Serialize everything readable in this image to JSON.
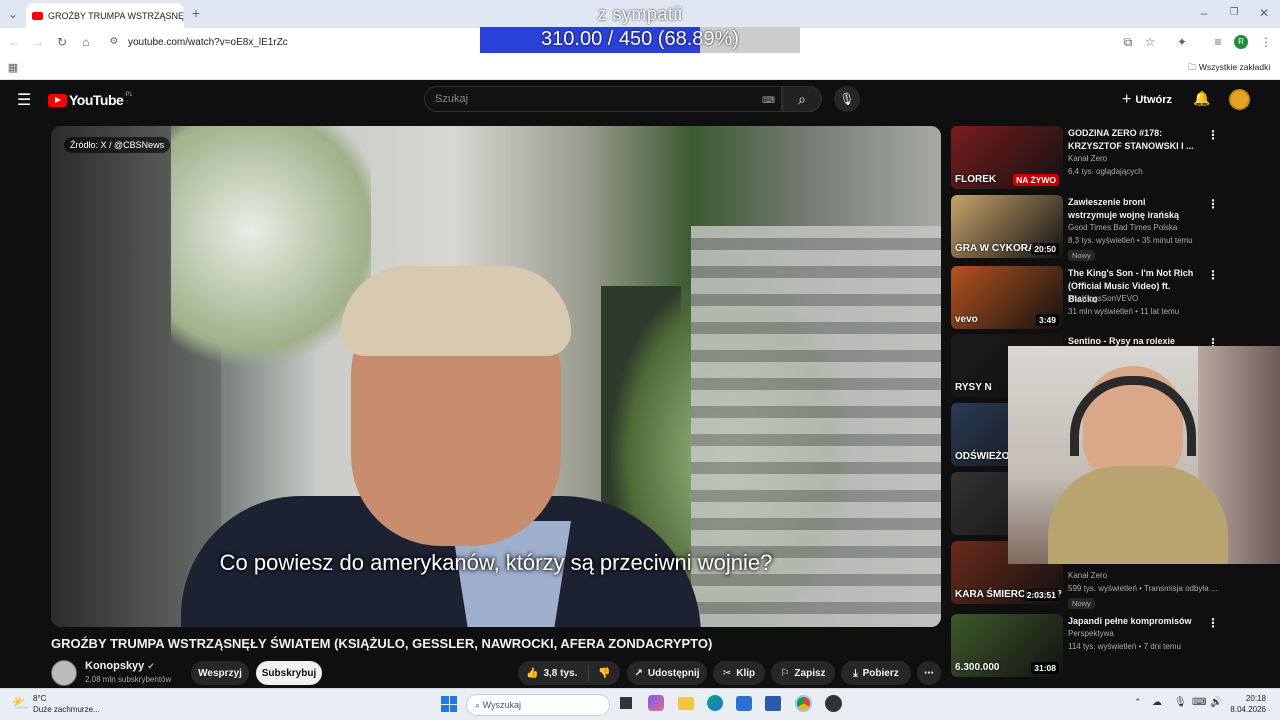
{
  "browser": {
    "tab_title": "GROŹBY TRUMPA WSTRZĄSNĘ",
    "url": "youtube.com/watch?v=oE8x_lE1rZc",
    "all_bookmarks": "Wszystkie zakładki",
    "profile_initial": "R"
  },
  "overlay": {
    "title": "z sympatii",
    "progress_text": "310.00 / 450 (68.89%)",
    "progress_fraction": 0.6889
  },
  "youtube": {
    "logo_text": "YouTube",
    "region": "PL",
    "search_placeholder": "Szukaj",
    "create_label": "Utwórz"
  },
  "video": {
    "source_label": "Źródło: X / @CBSNews",
    "subtitle": "Co powiesz do amerykanów, którzy są przeciwni wojnie?",
    "title": "GROŹBY TRUMPA WSTRZĄSNĘŁY ŚWIATEM (KSIĄŻULO, GESSLER, NAWROCKI, AFERA ZONDACRYPTO)",
    "channel": "Konopskyy",
    "subscribers": "2,08 mln subskrybentów",
    "support_label": "Wesprzyj",
    "subscribe_label": "Subskrybuj",
    "likes": "3,8 tys.",
    "share_label": "Udostępnij",
    "clip_label": "Klip",
    "save_label": "Zapisz",
    "download_label": "Pobierz"
  },
  "sidebar": [
    {
      "title": "GODZINA ZERO #178: KRZYSZTOF STANOWSKI I ...",
      "channel": "Kanał Zero",
      "meta": "6,4 tys. oglądających",
      "duration": "",
      "badge": "",
      "thumb_text": "FLOREK",
      "live_label": "NA ŻYWO",
      "thumb_color": "#7a1d1d"
    },
    {
      "title": "Zawieszenie broni wstrzymuje wojnę irańską",
      "channel": "Good Times Bad Times Polska",
      "meta": "8,3 tys. wyświetleń • 35 minut temu",
      "duration": "20:50",
      "badge": "Nowy",
      "thumb_text": "GRA W CYKORA?",
      "thumb_color": "#c7a36a"
    },
    {
      "title": "The King's Son - I'm Not Rich (Official Music Video) ft. Blacko",
      "channel": "TheKingsSonVEVO",
      "meta": "31 mln wyświetleń • 11 lat temu",
      "duration": "3:49",
      "badge": "",
      "thumb_text": "vevo",
      "thumb_color": "#b5531e"
    },
    {
      "title": "Sentino - Rysy na rolexie (prod.",
      "channel": "",
      "meta": "",
      "duration": "",
      "badge": "",
      "thumb_text": "RYSY N",
      "thumb_color": "#1a1a1a"
    },
    {
      "title": "",
      "channel": "",
      "meta": "",
      "duration": "",
      "badge": "",
      "thumb_text": "ODŚWIEŻONA LEGE",
      "thumb_color": "#2a3b55"
    },
    {
      "title": "",
      "channel": "",
      "meta": "",
      "duration": "",
      "badge": "",
      "thumb_text": "",
      "thumb_color": "#333333"
    },
    {
      "title": "",
      "channel": "Kanał Zero",
      "meta": "599 tys. wyświetleń • Transmisja odbyła ...",
      "duration": "2:03:51",
      "badge": "Nowy",
      "thumb_text": "KARA ŚMIERCI JEST?",
      "thumb_color": "#6b2a1a"
    },
    {
      "title": "Japandi pełne kompromisów",
      "channel": "Perspektywa",
      "meta": "114 tys. wyświetleń • 7 dni temu",
      "duration": "31:08",
      "badge": "",
      "thumb_text": "6.300.000",
      "thumb_color": "#3d5a2a"
    }
  ],
  "taskbar": {
    "weather_temp": "8°C",
    "weather_desc": "Duże zachmurze...",
    "search_placeholder": "Wyszukaj",
    "time": "20:18",
    "date": "8.04.2026"
  }
}
